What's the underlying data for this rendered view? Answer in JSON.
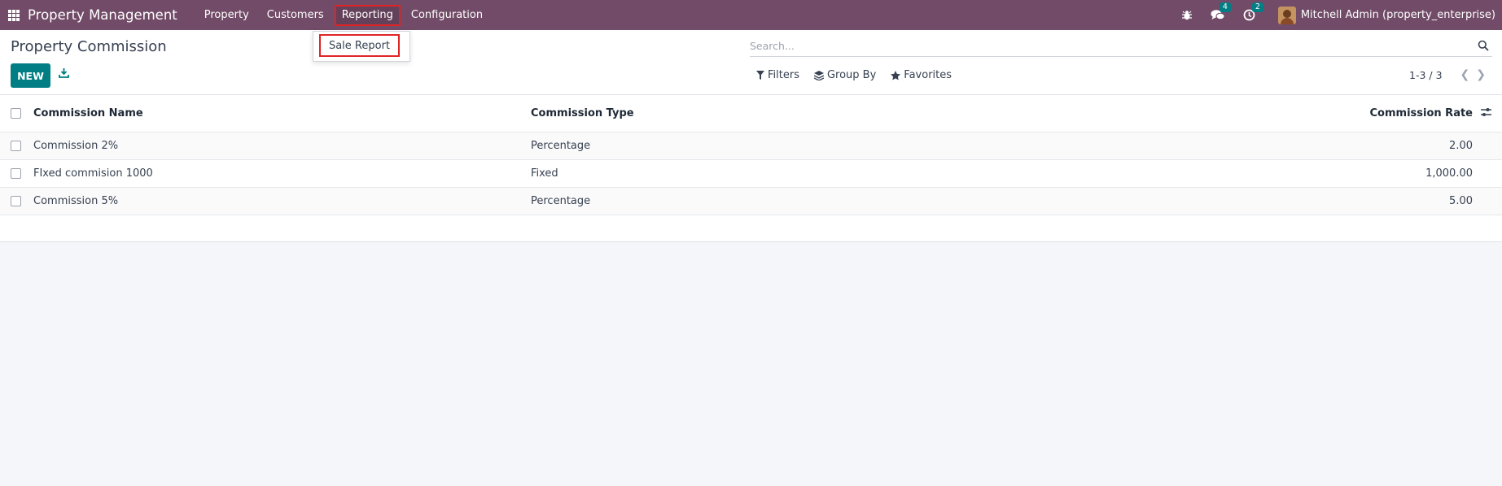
{
  "navbar": {
    "brand": "Property Management",
    "menu": [
      {
        "label": "Property"
      },
      {
        "label": "Customers"
      },
      {
        "label": "Reporting"
      },
      {
        "label": "Configuration"
      }
    ],
    "messages_count": "4",
    "activities_count": "2",
    "user_name": "Mitchell Admin (property_enterprise)",
    "bg_color": "#714b67"
  },
  "reporting_dropdown": {
    "items": [
      {
        "label": "Sale Report"
      }
    ]
  },
  "control_panel": {
    "title": "Property Commission",
    "new_label": "NEW",
    "search_placeholder": "Search...",
    "filters_label": "Filters",
    "group_by_label": "Group By",
    "favorites_label": "Favorites",
    "pager": "1-3 / 3",
    "accent_color": "#017e84"
  },
  "table": {
    "columns": {
      "name": "Commission Name",
      "type": "Commission Type",
      "rate": "Commission Rate"
    },
    "rows": [
      {
        "name": "Commission 2%",
        "type": "Percentage",
        "rate": "2.00"
      },
      {
        "name": "FIxed commision 1000",
        "type": "Fixed",
        "rate": "1,000.00"
      },
      {
        "name": "Commission 5%",
        "type": "Percentage",
        "rate": "5.00"
      }
    ]
  },
  "icons": [
    "apps-grid-icon",
    "bug-icon",
    "chat-icon",
    "clock-icon",
    "download-icon",
    "search-icon",
    "filter-icon",
    "layers-icon",
    "star-icon",
    "chevron-left-icon",
    "chevron-right-icon",
    "column-settings-icon"
  ]
}
